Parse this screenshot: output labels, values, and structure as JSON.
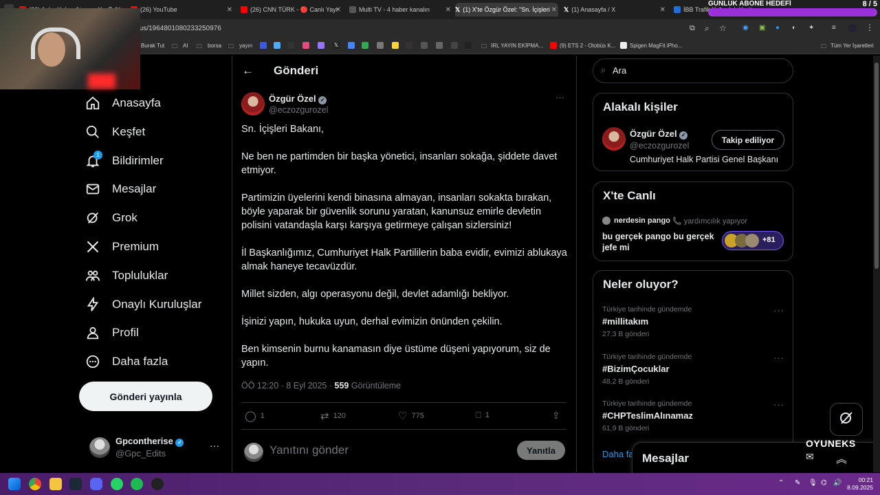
{
  "browser": {
    "tabs": [
      {
        "label": "(26) Anka Haber Ajansı - YouTub",
        "color": "#ff0000"
      },
      {
        "label": "(26) YouTube",
        "color": "#ff0000"
      },
      {
        "label": "(26) CNN TÜRK - 🔴 Canlı Yayı",
        "color": "#ff0000"
      },
      {
        "label": "Multi TV - 4 haber kanalın",
        "color": "#333333"
      },
      {
        "label": "(1) X'te Özgür Özel: \"Sn. İçişleri",
        "color": "#000000"
      },
      {
        "label": "(1) Anasayfa / X",
        "color": "#000000"
      },
      {
        "label": "İBB Trafik Yoğunluk Haritası",
        "color": "#1e6fd9"
      }
    ],
    "url": "tus/1964801080233250976",
    "bookmarks": [
      "Burak Tut",
      "AI",
      "borsa",
      "yayın",
      "IRL YAYIN EKİPMA...",
      "(9) ETS 2 - Otobüs K...",
      "Spigen MagFit iPho...",
      "Tüm Yer İşaretleri"
    ]
  },
  "stream_overlay": {
    "goal_title": "GÜNLÜK ABONE HEDEFİ",
    "goal_count": "8 / 5",
    "goal_progress": 1.0,
    "brand": "OYUNEKS"
  },
  "sidebar": {
    "items": [
      {
        "label": "Anasayfa",
        "icon": "home-icon"
      },
      {
        "label": "Keşfet",
        "icon": "search-icon"
      },
      {
        "label": "Bildirimler",
        "icon": "bell-icon",
        "badge": "1"
      },
      {
        "label": "Mesajlar",
        "icon": "mail-icon"
      },
      {
        "label": "Grok",
        "icon": "grok-icon"
      },
      {
        "label": "Premium",
        "icon": "x-logo-icon"
      },
      {
        "label": "Topluluklar",
        "icon": "people-icon"
      },
      {
        "label": "Onaylı Kuruluşlar",
        "icon": "lightning-icon"
      },
      {
        "label": "Profil",
        "icon": "person-icon"
      },
      {
        "label": "Daha fazla",
        "icon": "more-circle-icon"
      }
    ],
    "post_button": "Gönderi yayınla",
    "account": {
      "name": "Gpcontherise",
      "handle": "@Gpc_Edits"
    }
  },
  "main": {
    "title": "Gönderi",
    "tweet": {
      "author_name": "Özgür Özel",
      "author_handle": "@eczozgurozel",
      "text": "Sn. İçişleri Bakanı,\n\nNe ben ne partimden bir başka yönetici, insanları sokağa, şiddete davet etmiyor.\n\nPartimizin üyelerini kendi binasına almayan, insanları sokakta bırakan, böyle yaparak bir güvenlik sorunu yaratan, kanunsuz emirle devletin polisini vatandaşla karşı karşıya getirmeye çalışan sizlersiniz!\n\nİl Başkanlığımız, Cumhuriyet Halk Partililerin baba evidir, evimizi ablukaya almak haneye tecavüzdür.\n\nMillet sizden, algı operasyonu değil, devlet adamlığı bekliyor.\n\nİşinizi yapın, hukuka uyun, derhal evimizin önünden çekilin.\n\nBen kimsenin burnu kanamasın diye üstüme düşeni yapıyorum, siz de yapın.",
      "time": "ÖÖ 12:20 · 8 Eyl 2025 · ",
      "views_count": "559",
      "views_label": " Görüntüleme",
      "replies": "1",
      "reposts": "120",
      "likes": "775",
      "bookmarks": "1"
    },
    "reply_placeholder": "Yanıtını gönder",
    "reply_button": "Yanıtla"
  },
  "right": {
    "search_placeholder": "Ara",
    "relevant": {
      "title": "Alakalı kişiler",
      "name": "Özgür Özel",
      "handle": "@eczozgurozel",
      "bio": "Cumhuriyet Halk Partisi Genel Başkanı",
      "follow_label": "Takip ediliyor"
    },
    "live": {
      "title": "X'te Canlı",
      "host": "nerdesin pango",
      "host_status": "📞 yardımcılık yapıyor",
      "text": "bu gerçek pango bu gerçek jefe mi",
      "listeners": "+81"
    },
    "trends": {
      "title": "Neler oluyor?",
      "items": [
        {
          "context": "Türkiye tarihinde gündemde",
          "tag": "#millitakım",
          "count": "27,3 B gönderi"
        },
        {
          "context": "Türkiye tarihinde gündemde",
          "tag": "#BizimÇocuklar",
          "count": "48,2 B gönderi"
        },
        {
          "context": "Türkiye tarihinde gündemde",
          "tag": "#CHPTeslimAlınamaz",
          "count": "61,9 B gönderi"
        }
      ],
      "more": "Daha fa"
    },
    "messages_label": "Mesajlar"
  },
  "taskbar": {
    "time": "00:21",
    "date": "8.09.2025"
  }
}
